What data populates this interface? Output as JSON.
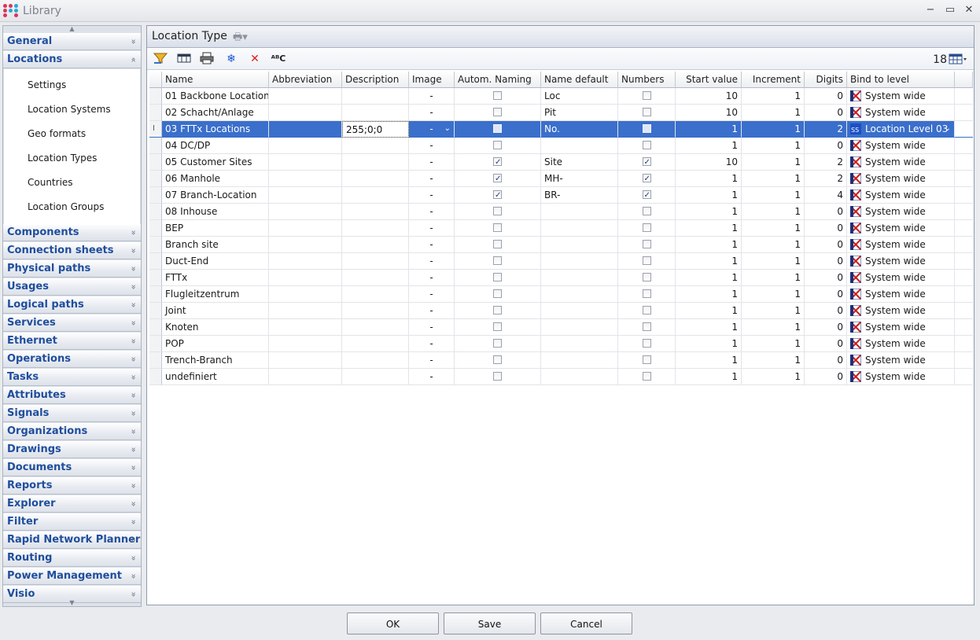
{
  "window": {
    "title": "Library"
  },
  "sidebar": {
    "groups_top": [
      {
        "label": "General",
        "chevron": "»"
      },
      {
        "label": "Locations",
        "chevron": "«"
      }
    ],
    "location_items": [
      "Settings",
      "Location Systems",
      "Geo formats",
      "Location Types",
      "Countries",
      "Location Groups"
    ],
    "groups_bottom": [
      "Components",
      "Connection sheets",
      "Physical paths",
      "Usages",
      "Logical paths",
      "Services",
      "Ethernet",
      "Operations",
      "Tasks",
      "Attributes",
      "Signals",
      "Organizations",
      "Drawings",
      "Documents",
      "Reports",
      "Explorer",
      "Filter",
      "Rapid Network Planner",
      "Routing",
      "Power Management",
      "Visio"
    ]
  },
  "panel": {
    "title": "Location Type"
  },
  "toolbar": {
    "count": "18",
    "icons": [
      "filter-icon",
      "table-layout-icon",
      "print-icon",
      "snowflake-icon",
      "delete-icon",
      "spellcheck-icon"
    ]
  },
  "grid": {
    "columns": [
      "Name",
      "Abbreviation",
      "Description",
      "Image",
      "Autom. Naming",
      "Name default",
      "Numbers",
      "Start value",
      "Increment",
      "Digits",
      "Bind to level"
    ],
    "rows": [
      {
        "name": "01 Backbone Locations",
        "abbr": "",
        "desc": "",
        "image": "-",
        "auto": false,
        "default": "Loc",
        "numbers": false,
        "start": "10",
        "inc": "1",
        "digits": "0",
        "level": "System wide"
      },
      {
        "name": "02 Schacht/Anlage",
        "abbr": "",
        "desc": "",
        "image": "-",
        "auto": false,
        "default": "Pit",
        "numbers": false,
        "start": "10",
        "inc": "1",
        "digits": "0",
        "level": "System wide"
      },
      {
        "name": "03 FTTx Locations",
        "abbr": "",
        "desc": "255;0;0",
        "image": "-",
        "auto": false,
        "default": "No.",
        "numbers": false,
        "start": "1",
        "inc": "1",
        "digits": "2",
        "level": "Location Level 03",
        "selected": true
      },
      {
        "name": "04 DC/DP",
        "abbr": "",
        "desc": "",
        "image": "-",
        "auto": false,
        "default": "",
        "numbers": false,
        "start": "1",
        "inc": "1",
        "digits": "0",
        "level": "System wide"
      },
      {
        "name": "05 Customer Sites",
        "abbr": "",
        "desc": "",
        "image": "-",
        "auto": true,
        "default": "Site",
        "numbers": true,
        "start": "10",
        "inc": "1",
        "digits": "2",
        "level": "System wide"
      },
      {
        "name": "06 Manhole",
        "abbr": "",
        "desc": "",
        "image": "-",
        "auto": true,
        "default": "MH-",
        "numbers": true,
        "start": "1",
        "inc": "1",
        "digits": "2",
        "level": "System wide"
      },
      {
        "name": "07 Branch-Location",
        "abbr": "",
        "desc": "",
        "image": "-",
        "auto": true,
        "default": "BR-",
        "numbers": true,
        "start": "1",
        "inc": "1",
        "digits": "4",
        "level": "System wide"
      },
      {
        "name": "08 Inhouse",
        "abbr": "",
        "desc": "",
        "image": "-",
        "auto": false,
        "default": "",
        "numbers": false,
        "start": "1",
        "inc": "1",
        "digits": "0",
        "level": "System wide"
      },
      {
        "name": "BEP",
        "abbr": "",
        "desc": "",
        "image": "-",
        "auto": false,
        "default": "",
        "numbers": false,
        "start": "1",
        "inc": "1",
        "digits": "0",
        "level": "System wide"
      },
      {
        "name": "Branch site",
        "abbr": "",
        "desc": "",
        "image": "-",
        "auto": false,
        "default": "",
        "numbers": false,
        "start": "1",
        "inc": "1",
        "digits": "0",
        "level": "System wide"
      },
      {
        "name": "Duct-End",
        "abbr": "",
        "desc": "",
        "image": "-",
        "auto": false,
        "default": "",
        "numbers": false,
        "start": "1",
        "inc": "1",
        "digits": "0",
        "level": "System wide"
      },
      {
        "name": "FTTx",
        "abbr": "",
        "desc": "",
        "image": "-",
        "auto": false,
        "default": "",
        "numbers": false,
        "start": "1",
        "inc": "1",
        "digits": "0",
        "level": "System wide"
      },
      {
        "name": "Flugleitzentrum",
        "abbr": "",
        "desc": "",
        "image": "-",
        "auto": false,
        "default": "",
        "numbers": false,
        "start": "1",
        "inc": "1",
        "digits": "0",
        "level": "System wide"
      },
      {
        "name": "Joint",
        "abbr": "",
        "desc": "",
        "image": "-",
        "auto": false,
        "default": "",
        "numbers": false,
        "start": "1",
        "inc": "1",
        "digits": "0",
        "level": "System wide"
      },
      {
        "name": "Knoten",
        "abbr": "",
        "desc": "",
        "image": "-",
        "auto": false,
        "default": "",
        "numbers": false,
        "start": "1",
        "inc": "1",
        "digits": "0",
        "level": "System wide"
      },
      {
        "name": "POP",
        "abbr": "",
        "desc": "",
        "image": "-",
        "auto": false,
        "default": "",
        "numbers": false,
        "start": "1",
        "inc": "1",
        "digits": "0",
        "level": "System wide"
      },
      {
        "name": "Trench-Branch",
        "abbr": "",
        "desc": "",
        "image": "-",
        "auto": false,
        "default": "",
        "numbers": false,
        "start": "1",
        "inc": "1",
        "digits": "0",
        "level": "System wide"
      },
      {
        "name": "undefiniert",
        "abbr": "",
        "desc": "",
        "image": "-",
        "auto": false,
        "default": "",
        "numbers": false,
        "start": "1",
        "inc": "1",
        "digits": "0",
        "level": "System wide"
      }
    ]
  },
  "buttons": {
    "ok": "OK",
    "save": "Save",
    "cancel": "Cancel"
  },
  "colors": {
    "accent": "#1f4e9c",
    "selection": "#3a6fcb"
  }
}
